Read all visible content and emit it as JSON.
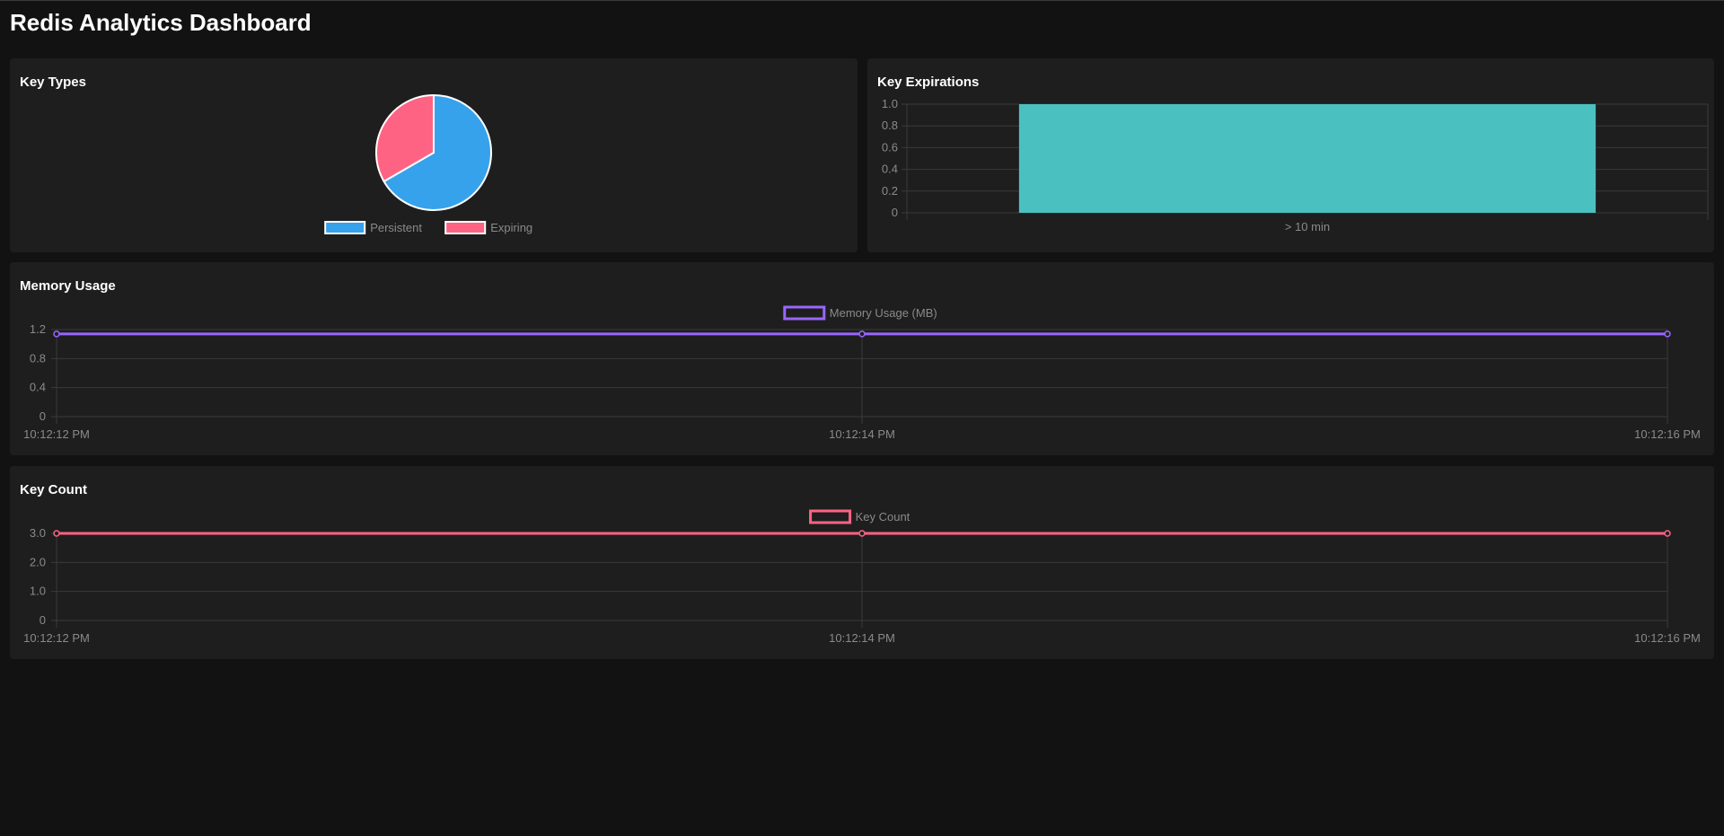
{
  "page": {
    "title": "Redis Analytics Dashboard"
  },
  "panels": {
    "key_types": {
      "title": "Key Types"
    },
    "key_expirations": {
      "title": "Key Expirations"
    },
    "memory_usage": {
      "title": "Memory Usage"
    },
    "key_count": {
      "title": "Key Count"
    }
  },
  "chart_data": [
    {
      "id": "key_types",
      "type": "pie",
      "title": "",
      "labels": [
        "Persistent",
        "Expiring"
      ],
      "values": [
        2,
        1
      ],
      "colors": [
        "#36a2eb",
        "#ff6384"
      ],
      "legend": "bottom"
    },
    {
      "id": "key_expirations",
      "type": "bar",
      "title": "",
      "categories": [
        "> 10 min"
      ],
      "values": [
        1
      ],
      "color": "#4bc0c0",
      "ylim": [
        0,
        1
      ],
      "yticks": [
        "1.0",
        "0.8",
        "0.6",
        "0.4",
        "0.2",
        "0"
      ],
      "grid": true,
      "legend": "none"
    },
    {
      "id": "memory_usage",
      "type": "line",
      "title": "",
      "x": [
        "10:12:12 PM",
        "10:12:14 PM",
        "10:12:16 PM"
      ],
      "series": [
        {
          "name": "Memory Usage (MB)",
          "values": [
            1.14,
            1.14,
            1.14
          ]
        }
      ],
      "color": "#9966ff",
      "ylim": [
        0,
        1.2
      ],
      "yticks": [
        "1.2",
        "0.8",
        "0.4",
        "0"
      ],
      "grid": true,
      "legend": "top"
    },
    {
      "id": "key_count",
      "type": "line",
      "title": "",
      "x": [
        "10:12:12 PM",
        "10:12:14 PM",
        "10:12:16 PM"
      ],
      "series": [
        {
          "name": "Key Count",
          "values": [
            3,
            3,
            3
          ]
        }
      ],
      "color": "#ff6384",
      "ylim": [
        0,
        3
      ],
      "yticks": [
        "3.0",
        "2.0",
        "1.0",
        "0"
      ],
      "grid": true,
      "legend": "top"
    }
  ]
}
